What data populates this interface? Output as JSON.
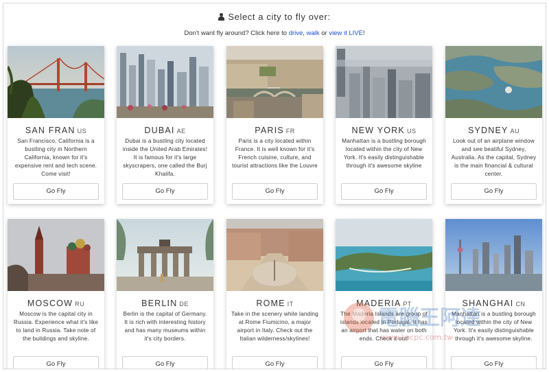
{
  "header": {
    "title": "Select a city to fly over:",
    "subtitle_prefix": "Don't want fly around? Click here to ",
    "link_drive": "drive",
    "sep1": ", ",
    "link_walk": "walk",
    "sep2": " or ",
    "link_live": "view it LIVE",
    "subtitle_suffix": "!"
  },
  "cities": [
    {
      "name": "SAN FRAN",
      "code": "US",
      "desc": "San Francisco, California is a bustling city in Northern California, known for it's expensive rent and tech scene. Come visit!",
      "button": "Go Fly"
    },
    {
      "name": "DUBAI",
      "code": "AE",
      "desc": "Dubai is a bustling city located inside the United Arab Emirates! It is famous for it's large skyscrapers, one called the Burj Khalifa.",
      "button": "Go Fly"
    },
    {
      "name": "PARIS",
      "code": "FR",
      "desc": "Paris is a city located within France. It is well known for it's French cuisine, culture, and tourist attractions like the Louvre",
      "button": "Go Fly"
    },
    {
      "name": "NEW YORK",
      "code": "US",
      "desc": "Manhattan is a bustling borough located within the city of New York. It's easily distinguishable through it's awesome skyline",
      "button": "Go Fly"
    },
    {
      "name": "SYDNEY",
      "code": "AU",
      "desc": "Look out of an airplane window and see beatiful Sydney, Australia. As the capital, Sydney is the main financial & cultural center.",
      "button": "Go Fly"
    },
    {
      "name": "MOSCOW",
      "code": "RU",
      "desc": "Moscow is the capital city in Russia. Experience what it's like to land in Russia. Take note of the buildings and skyline.",
      "button": "Go Fly"
    },
    {
      "name": "BERLIN",
      "code": "DE",
      "desc": "Berlin is the capital of Germany. It is rich with interesting history and has many museums within it's city borders.",
      "button": "Go Fly"
    },
    {
      "name": "ROME",
      "code": "IT",
      "desc": "Take in the scenery while landing at Rome Fiumicino, a major airport in Italy. Check out the Italian wilderness/skylines!",
      "button": "Go Fly"
    },
    {
      "name": "MADERIA",
      "code": "PT",
      "desc": "The Maderia Islands are group of islands located in Portugal. It has an airport that has water on both ends. Check it out!",
      "button": "Go Fly"
    },
    {
      "name": "SHANGHAI",
      "code": "CN",
      "desc": "Manhattan is a bustling borough located within the city of New York. It's easily distinguishable through it's awesome skyline.",
      "button": "Go Fly"
    }
  ],
  "watermark": {
    "text": "電腦王阿達",
    "url": "www.kocpc.com.tw"
  }
}
